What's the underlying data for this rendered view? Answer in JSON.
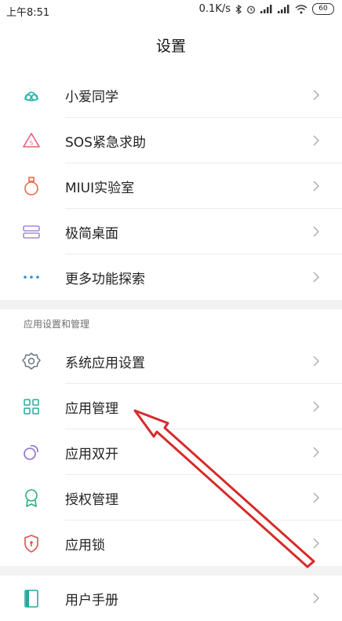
{
  "status": {
    "time": "上午8:51",
    "net": "0.1K/s",
    "battery": "60"
  },
  "header": {
    "title": "设置"
  },
  "group1": [
    {
      "label": "小爱同学",
      "icon": "xiaoai-icon"
    },
    {
      "label": "SOS紧急求助",
      "icon": "sos-icon"
    },
    {
      "label": "MIUI实验室",
      "icon": "flask-icon"
    },
    {
      "label": "极简桌面",
      "icon": "minimal-desktop-icon"
    },
    {
      "label": "更多功能探索",
      "icon": "more-dots-icon"
    }
  ],
  "section": {
    "label": "应用设置和管理"
  },
  "group2": [
    {
      "label": "系统应用设置",
      "icon": "gear-icon"
    },
    {
      "label": "应用管理",
      "icon": "grid-icon"
    },
    {
      "label": "应用双开",
      "icon": "dual-apps-icon"
    },
    {
      "label": "授权管理",
      "icon": "award-icon"
    },
    {
      "label": "应用锁",
      "icon": "shield-lock-icon"
    }
  ],
  "group3": [
    {
      "label": "用户手册",
      "icon": "manual-icon"
    }
  ],
  "colors": {
    "accent_teal": "#2bb5a8",
    "arrow_red": "#d62b2b"
  }
}
